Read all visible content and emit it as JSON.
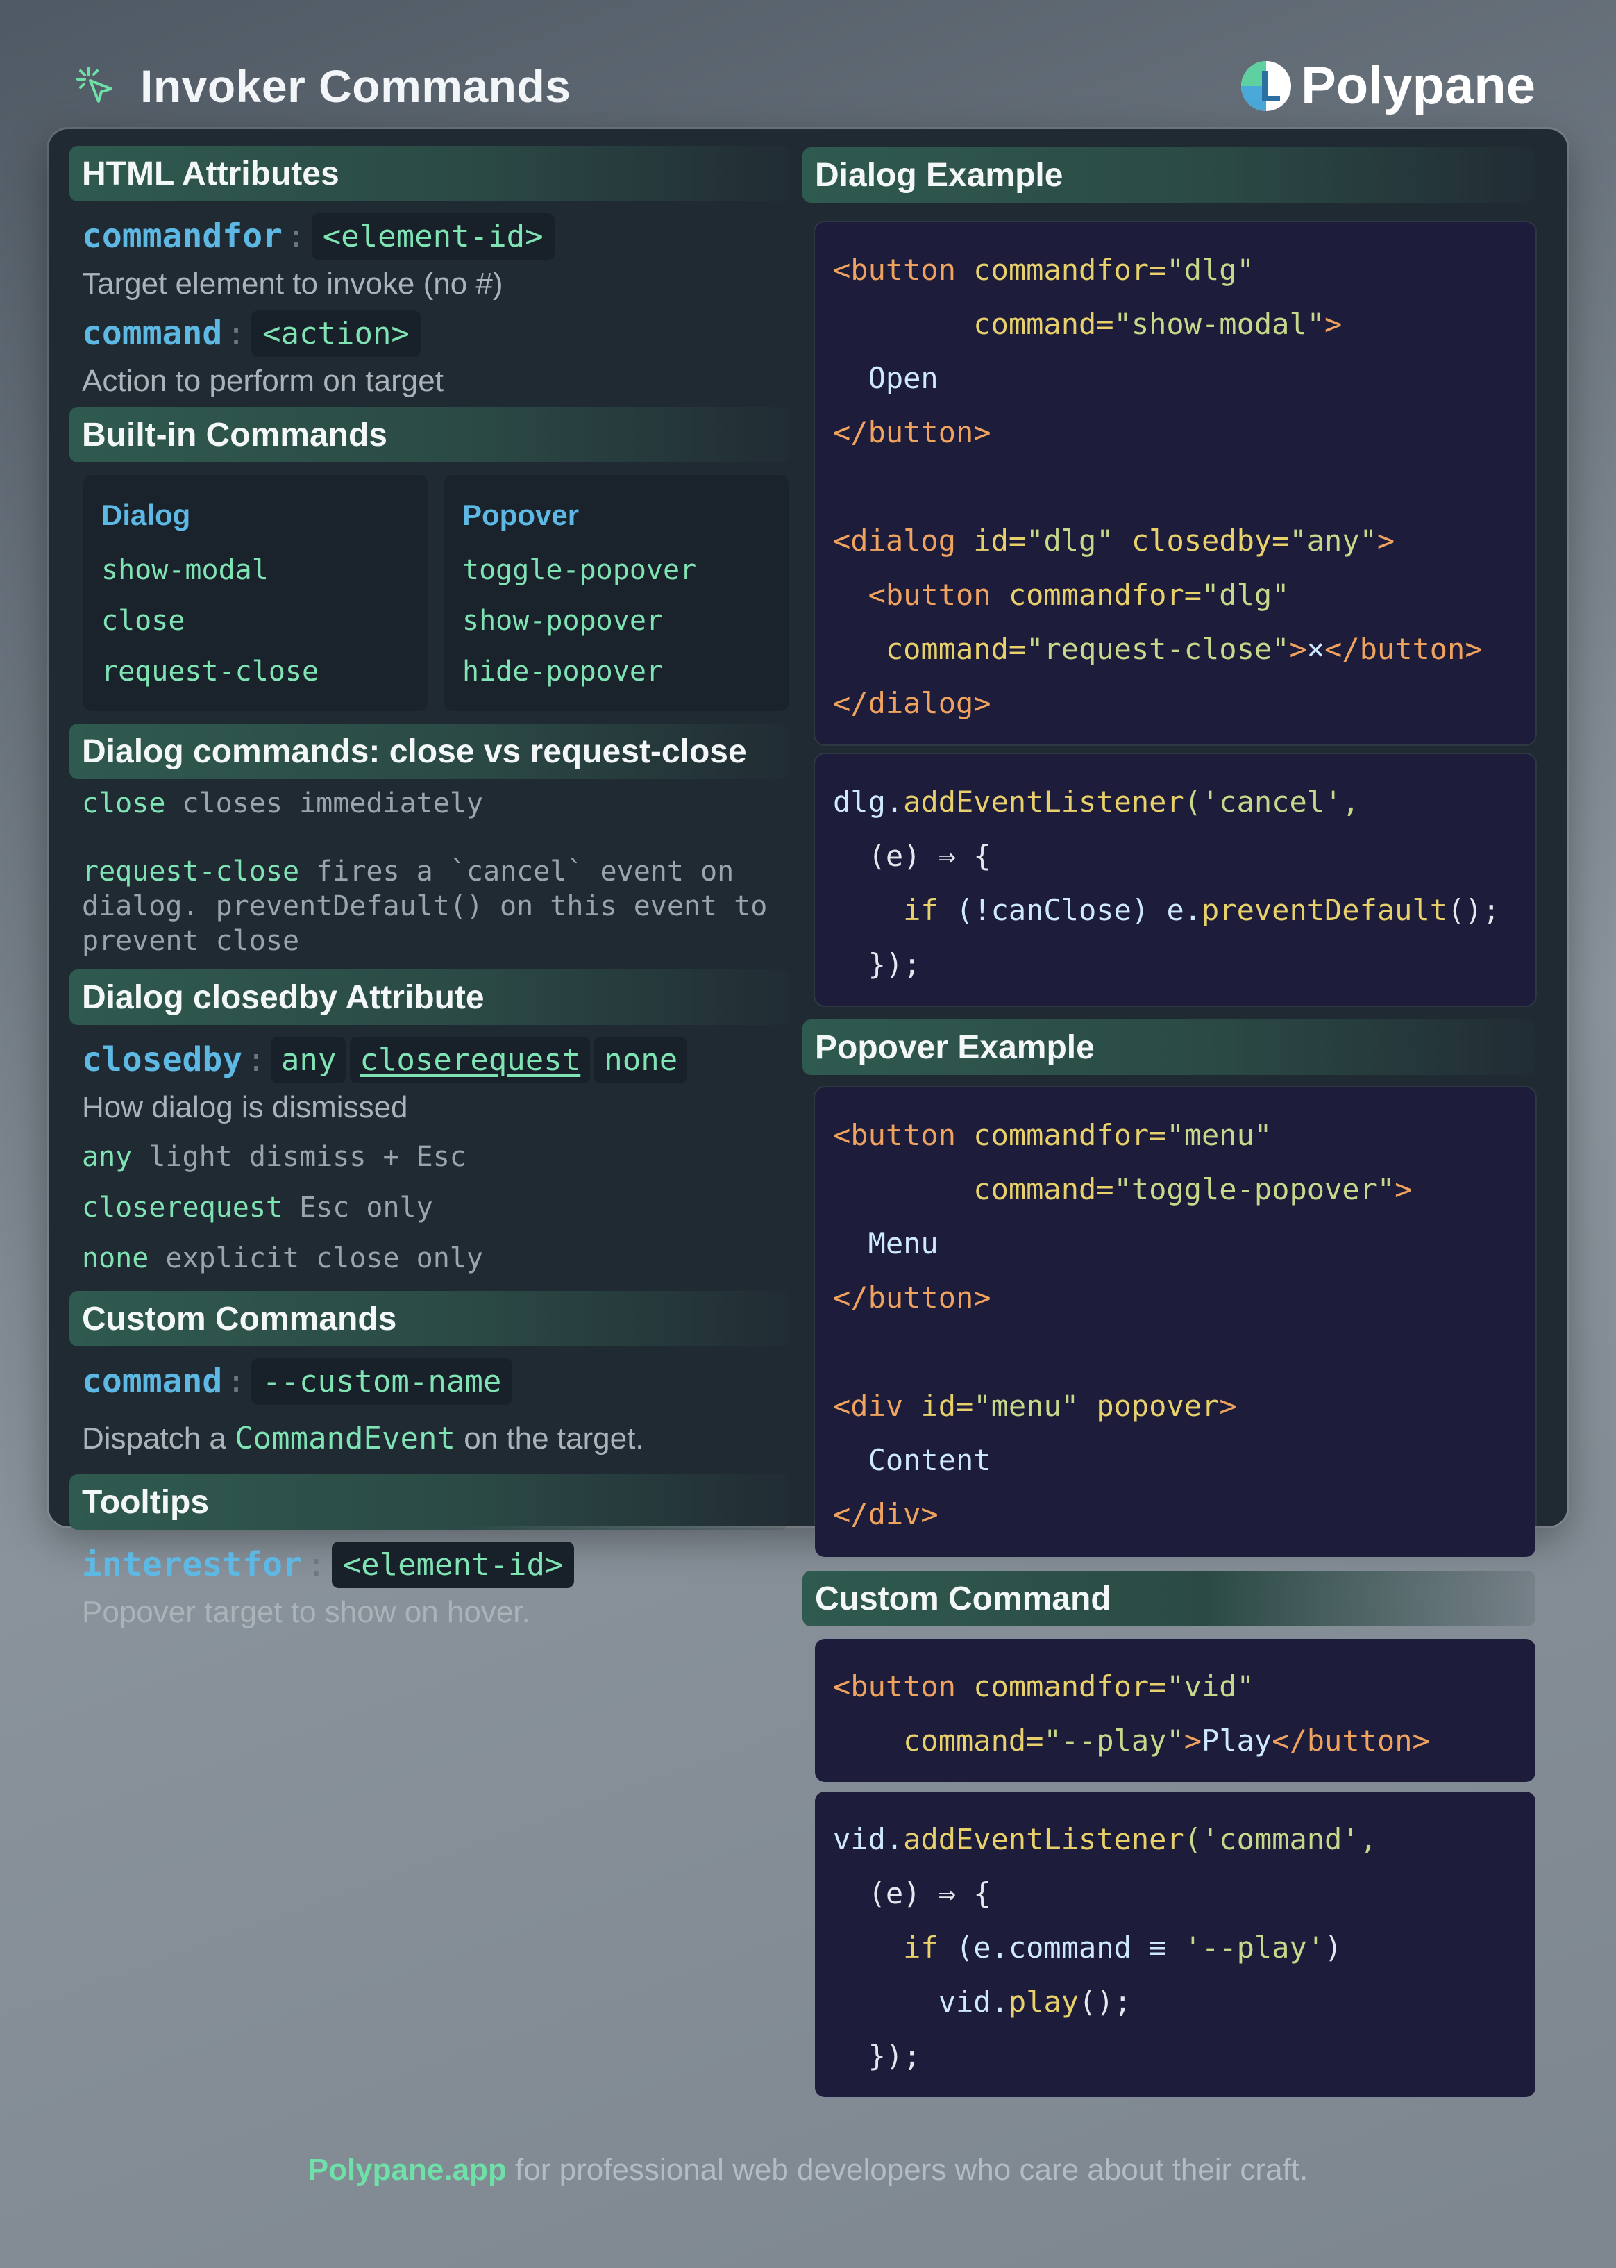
{
  "header": {
    "title": "Invoker Commands",
    "brand": "Polypane"
  },
  "html_attributes": {
    "heading": "HTML Attributes",
    "commandfor": {
      "name": "commandfor",
      "value": "<element-id>",
      "desc": "Target element to invoke (no #)"
    },
    "command": {
      "name": "command",
      "value": "<action>",
      "desc": "Action to perform on target"
    }
  },
  "builtin": {
    "heading": "Built-in Commands",
    "dialog": {
      "title": "Dialog",
      "items": [
        "show-modal",
        "close",
        "request-close"
      ]
    },
    "popover": {
      "title": "Popover",
      "items": [
        "toggle-popover",
        "show-popover",
        "hide-popover"
      ]
    }
  },
  "close_vs": {
    "heading": "Dialog commands: close vs request-close",
    "line1_kw": "close",
    "line1_text": " closes immediately",
    "line2_kw": "request-close",
    "line2_text": " fires a `cancel` event on dialog. preventDefault() on this event to prevent close"
  },
  "closedby": {
    "heading": "Dialog closedby Attribute",
    "name": "closedby",
    "values": [
      "any",
      "closerequest",
      "none"
    ],
    "desc": "How dialog is dismissed",
    "rows": [
      {
        "kw": "any",
        "text": " light dismiss + Esc"
      },
      {
        "kw": "closerequest",
        "text": " Esc only"
      },
      {
        "kw": "none",
        "text": " explicit close only"
      }
    ]
  },
  "custom": {
    "heading": "Custom Commands",
    "name": "command",
    "value": "--custom-name",
    "desc_pre": "Dispatch a ",
    "desc_code": "CommandEvent",
    "desc_post": " on the target."
  },
  "tooltips": {
    "heading": "Tooltips",
    "name": "interestfor",
    "value": "<element-id>",
    "desc": "Popover target to show on hover."
  },
  "dialog_example": {
    "heading": "Dialog Example",
    "markup": {
      "l1_tag": "<button",
      "l1_attr": " commandfor=",
      "l1_str": "\"dlg\"",
      "l2_attr": "        command=",
      "l2_str": "\"show-modal\"",
      "l2_tag": ">",
      "l3_text": "  Open",
      "l4_tag": "</button>",
      "l6_tag": "<dialog",
      "l6_attr1": " id=",
      "l6_str1": "\"dlg\"",
      "l6_attr2": " closedby=",
      "l6_str2": "\"any\"",
      "l6_end": ">",
      "l7_tag": "  <button",
      "l7_attr": " commandfor=",
      "l7_str": "\"dlg\"",
      "l8_attr": "   command=",
      "l8_str": "\"request-close\"",
      "l8_tag": ">",
      "l8_text": "×",
      "l8_close": "</button>",
      "l9_tag": "</dialog>"
    },
    "script": {
      "l1_obj": "dlg.",
      "l1_fn": "addEventListener",
      "l1_str": "('cancel',",
      "l2": "  (e) ⇒ {",
      "l3_kw": "    if",
      "l3_text": " (!canClose) e.",
      "l3_fn": "preventDefault",
      "l3_end": "();",
      "l4": "  });"
    }
  },
  "popover_example": {
    "heading": "Popover Example",
    "l1_tag": "<button",
    "l1_attr": " commandfor=",
    "l1_str": "\"menu\"",
    "l2_attr": "        command=",
    "l2_str": "\"toggle-popover\"",
    "l2_tag": ">",
    "l3_text": "  Menu",
    "l4_tag": "</button>",
    "l6_tag": "<div",
    "l6_attr": " id=",
    "l6_str": "\"menu\"",
    "l6_attr2": " popover",
    "l6_end": ">",
    "l7_text": "  Content",
    "l8_tag": "</div>"
  },
  "custom_command": {
    "heading": "Custom Command",
    "markup": {
      "l1_tag": "<button",
      "l1_attr": " commandfor=",
      "l1_str": "\"vid\"",
      "l2_attr": "    command=",
      "l2_str": "\"--play\"",
      "l2_tag": ">",
      "l2_text": "Play",
      "l2_close": "</button>"
    },
    "script": {
      "l1_obj": "vid.",
      "l1_fn": "addEventListener",
      "l1_str": "('command',",
      "l2": "  (e) ⇒ {",
      "l3_kw": "    if",
      "l3_text": " (e.command ≡ ",
      "l3_str": "'--play'",
      "l3_end": ")",
      "l4_obj": "      vid.",
      "l4_fn": "play",
      "l4_end": "();",
      "l5": "  });"
    }
  },
  "footer": {
    "link": "Polypane.app",
    "text": " for professional web developers who care about their craft."
  },
  "colors": {
    "accent_green": "#7fe3b4",
    "accent_blue": "#5eb8e4",
    "code_bg": "#1d1c3a",
    "panel_bg": "#202a33"
  }
}
